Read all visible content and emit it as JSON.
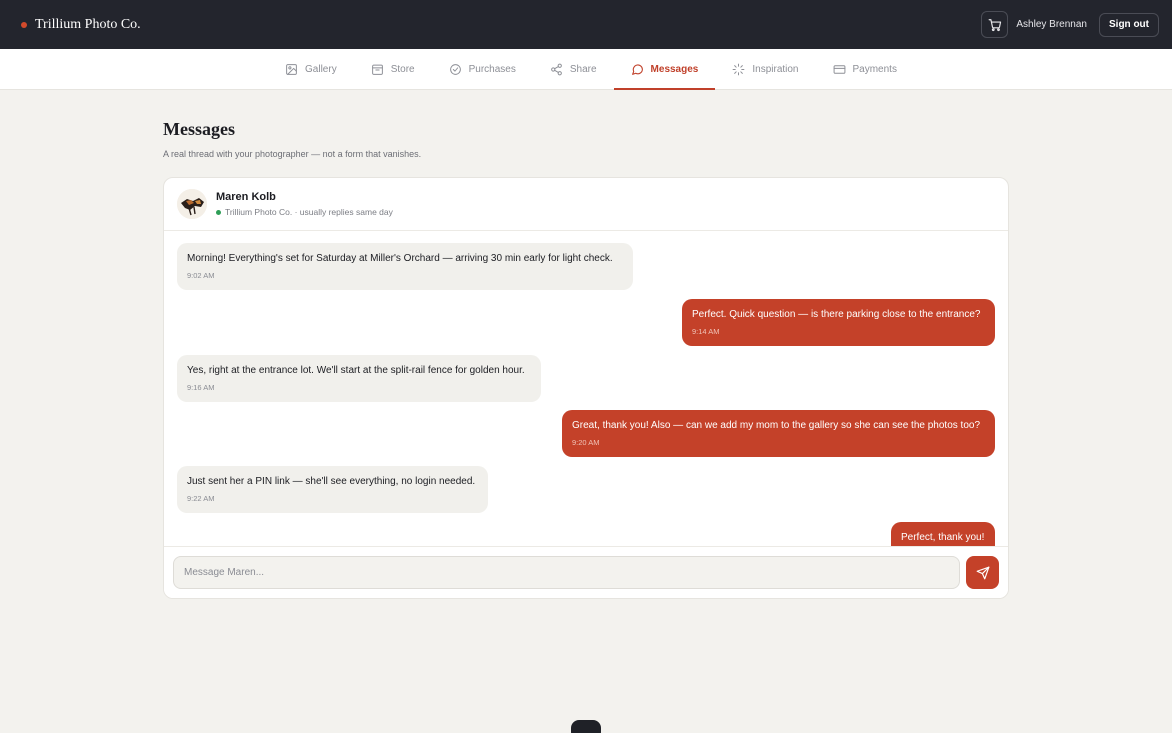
{
  "app": {
    "brand": "Trillium Photo Co."
  },
  "header": {
    "user_name": "Ashley Brennan",
    "signout_label": "Sign out"
  },
  "nav": {
    "tabs": [
      {
        "label": "Gallery",
        "icon": "image-icon"
      },
      {
        "label": "Store",
        "icon": "store-icon"
      },
      {
        "label": "Purchases",
        "icon": "check-circle-icon"
      },
      {
        "label": "Share",
        "icon": "share-icon"
      },
      {
        "label": "Messages",
        "icon": "message-icon",
        "active": true
      },
      {
        "label": "Inspiration",
        "icon": "sparkle-icon"
      },
      {
        "label": "Payments",
        "icon": "card-icon"
      }
    ]
  },
  "page": {
    "title": "Messages",
    "subtitle": "A real thread with your photographer — not a form that vanishes."
  },
  "contact": {
    "name": "Maren Kolb",
    "meta": "Trillium Photo Co. · usually replies same day",
    "status_color": "#2e9e57"
  },
  "messages": [
    {
      "dir": "in",
      "text": "Morning! Everything's set for Saturday at Miller's Orchard — arriving 30 min early for light check.",
      "time": "9:02 AM"
    },
    {
      "dir": "out",
      "text": "Perfect. Quick question — is there parking close to the entrance?",
      "time": "9:14 AM"
    },
    {
      "dir": "in",
      "text": "Yes, right at the entrance lot. We'll start at the split-rail fence for golden hour.",
      "time": "9:16 AM"
    },
    {
      "dir": "out",
      "text": "Great, thank you! Also — can we add my mom to the gallery so she can see the photos too?",
      "time": "9:20 AM"
    },
    {
      "dir": "in",
      "text": "Just sent her a PIN link — she'll see everything, no login needed.",
      "time": "9:22 AM"
    },
    {
      "dir": "out",
      "text": "Perfect, thank you!",
      "time": ""
    }
  ],
  "composer": {
    "placeholder": "Message Maren..."
  },
  "colors": {
    "accent": "#c44129",
    "topbar": "#23252d",
    "background": "#f3f2ee"
  }
}
